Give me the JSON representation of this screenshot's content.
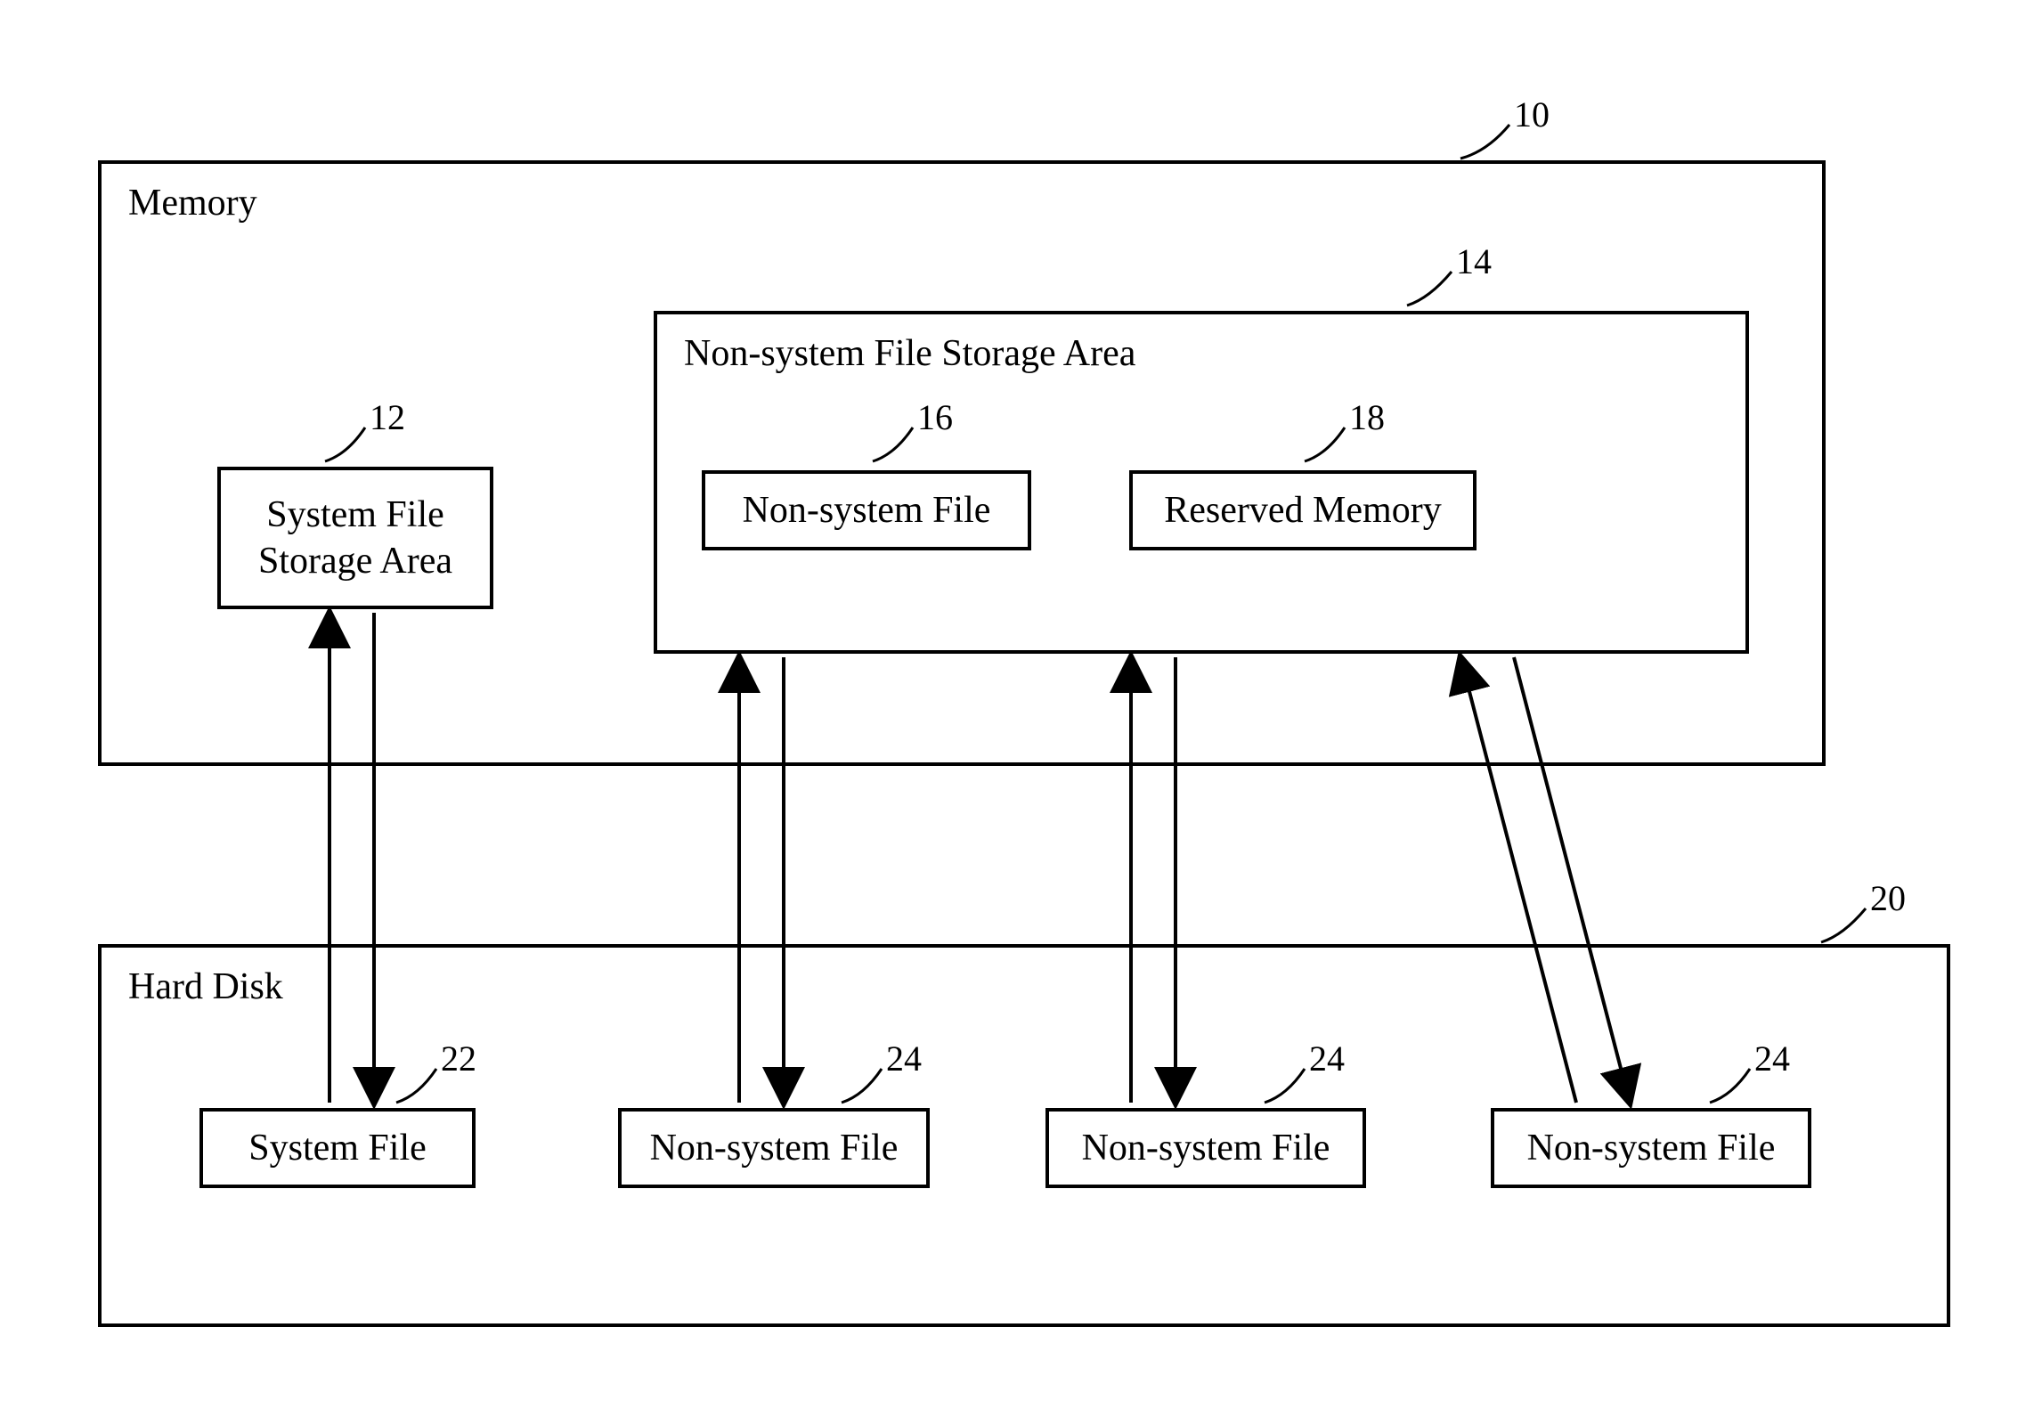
{
  "memory": {
    "title": "Memory",
    "ref": "10",
    "systemFileStorageArea": {
      "label": "System File\nStorage Area",
      "ref": "12"
    },
    "nonSystemFileStorageArea": {
      "title": "Non-system File Storage Area",
      "ref": "14",
      "nonSystemFile": {
        "label": "Non-system File",
        "ref": "16"
      },
      "reservedMemory": {
        "label": "Reserved Memory",
        "ref": "18"
      }
    }
  },
  "hardDisk": {
    "title": "Hard Disk",
    "ref": "20",
    "systemFile": {
      "label": "System File",
      "ref": "22"
    },
    "nonSystemFile1": {
      "label": "Non-system File",
      "ref": "24"
    },
    "nonSystemFile2": {
      "label": "Non-system File",
      "ref": "24"
    },
    "nonSystemFile3": {
      "label": "Non-system File",
      "ref": "24"
    }
  }
}
